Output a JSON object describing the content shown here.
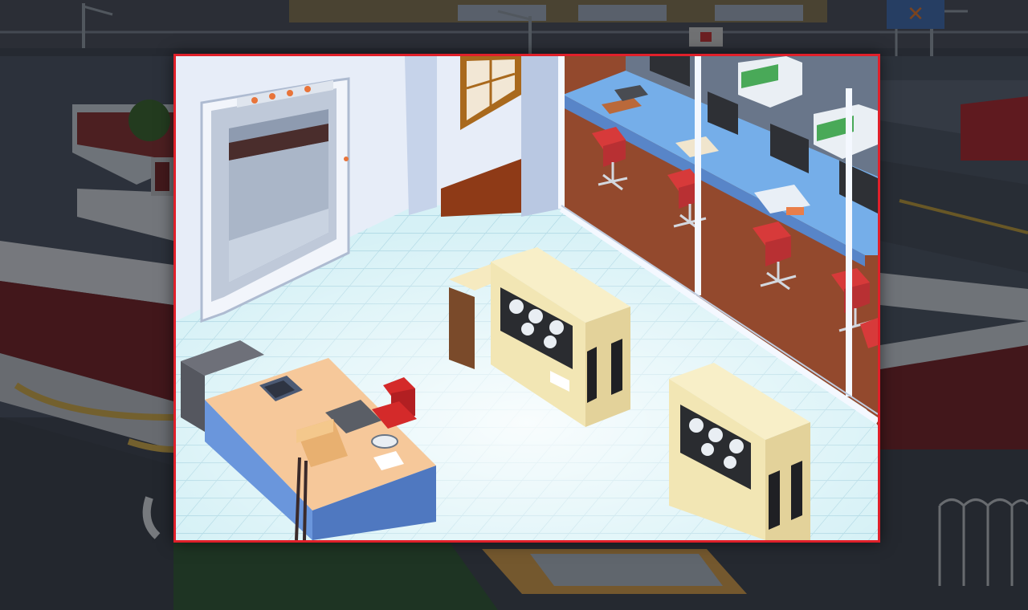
{
  "scene": {
    "background": "isometric-city-street",
    "room": "computer-room",
    "dimmed": true
  },
  "viewport": {
    "frame_color": "#e0202a"
  },
  "colors": {
    "floor_tile": "#cfeef5",
    "wall": "#e3ebf7",
    "carpet": "#8a3a1c",
    "cabinet": "#f2e6b4",
    "desk_top": "#f6c89a",
    "desk_side": "#6a96dc",
    "chair": "#d42a2a",
    "counter": "#6aa8e8"
  },
  "objects": {
    "elevator": "elevator-doors",
    "tape_drives": [
      "tape-drive-cabinet",
      "tape-drive-cabinet"
    ],
    "terminals": [
      "monitor",
      "monitor",
      "monitor",
      "monitor"
    ],
    "chairs": [
      "office-chair",
      "office-chair",
      "office-chair",
      "office-chair",
      "office-chair"
    ]
  }
}
